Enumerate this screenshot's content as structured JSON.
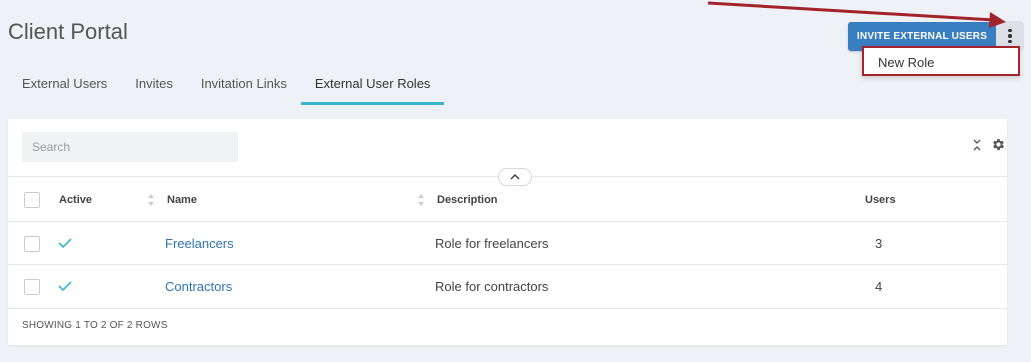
{
  "header": {
    "title": "Client Portal",
    "invite_button": "INVITE EXTERNAL USERS",
    "more_menu_icon": "kebab-icon"
  },
  "dropdown": {
    "items": [
      "New Role"
    ]
  },
  "tabs": [
    {
      "label": "External Users",
      "active": false
    },
    {
      "label": "Invites",
      "active": false
    },
    {
      "label": "Invitation Links",
      "active": false
    },
    {
      "label": "External User Roles",
      "active": true
    }
  ],
  "toolbar": {
    "search_placeholder": "Search",
    "icons": [
      "collapse-icon",
      "gear-icon"
    ]
  },
  "table": {
    "columns": [
      "Active",
      "Name",
      "Description",
      "Users"
    ],
    "rows": [
      {
        "active": true,
        "name": "Freelancers",
        "description": "Role for freelancers",
        "users": "3"
      },
      {
        "active": true,
        "name": "Contractors",
        "description": "Role for contractors",
        "users": "4"
      }
    ],
    "footer": "SHOWING 1 TO 2 OF 2 ROWS"
  },
  "colors": {
    "accent": "#39b7cf",
    "primary_button": "#3a7ec2",
    "link": "#2e74b5",
    "annotation": "#a3232a"
  }
}
